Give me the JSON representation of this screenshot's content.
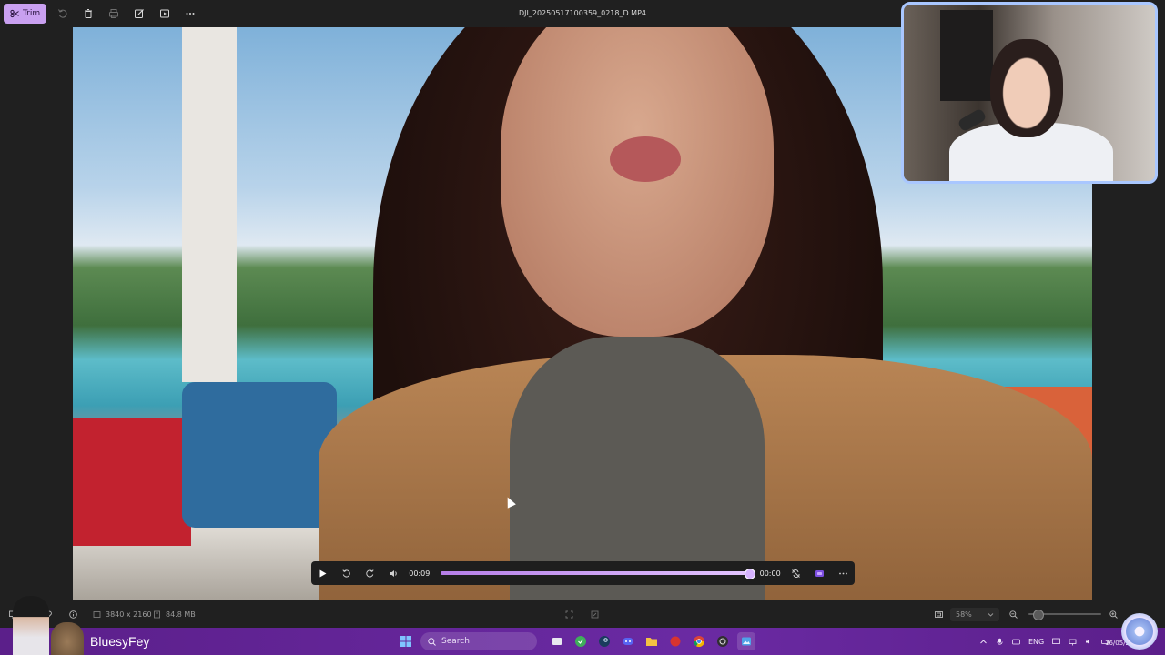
{
  "toolbar": {
    "trim_label": "Trim",
    "file_name": "DJI_20250517100359_0218_D.MP4",
    "icons": [
      "trim-icon",
      "rotate-icon",
      "delete-icon",
      "print-icon",
      "edit-icon",
      "slideshow-icon",
      "more-icon"
    ]
  },
  "player": {
    "current_time": "00:09",
    "end_time": "00:00",
    "progress": 1.0
  },
  "status": {
    "resolution": "3840 x 2160",
    "file_size": "84.8 MB",
    "zoom": "58%",
    "zoom_level": 0.12
  },
  "taskbar": {
    "streamer_name": "BluesyFey",
    "search_placeholder": "Search",
    "language": "ENG",
    "date": "16/05/2..."
  },
  "colors": {
    "accent": "#c9a0f0",
    "taskbar": "#6a2aa3",
    "webcam_border": "#a9c7ff"
  }
}
